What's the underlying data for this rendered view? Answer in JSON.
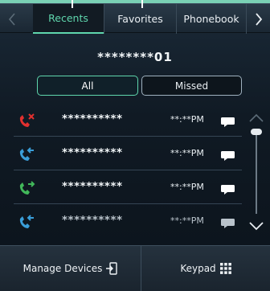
{
  "tabs": [
    "Recents",
    "Favorites",
    "Phonebook"
  ],
  "active_tab": "Recents",
  "caller_number": "********01",
  "filter": {
    "all": "All",
    "missed": "Missed"
  },
  "calls": [
    {
      "type": "missed",
      "icon": "missed-call-icon",
      "number": "**********",
      "time": "**:**PM",
      "icon_color": "#e2302f"
    },
    {
      "type": "incoming",
      "icon": "incoming-call-icon",
      "number": "**********",
      "time": "**:**PM",
      "icon_color": "#3a9ed9"
    },
    {
      "type": "outgoing",
      "icon": "outgoing-call-icon",
      "number": "**********",
      "time": "**:**PM",
      "icon_color": "#41b85a"
    },
    {
      "type": "incoming",
      "icon": "incoming-call-icon",
      "number": "**********",
      "time": "**:**PM",
      "icon_color": "#3a9ed9"
    }
  ],
  "bottom": {
    "manage": "Manage Devices",
    "keypad": "Keypad"
  },
  "colors": {
    "accent": "#5fd6ad",
    "missed": "#e2302f",
    "incoming": "#3a9ed9",
    "outgoing": "#41b85a"
  }
}
